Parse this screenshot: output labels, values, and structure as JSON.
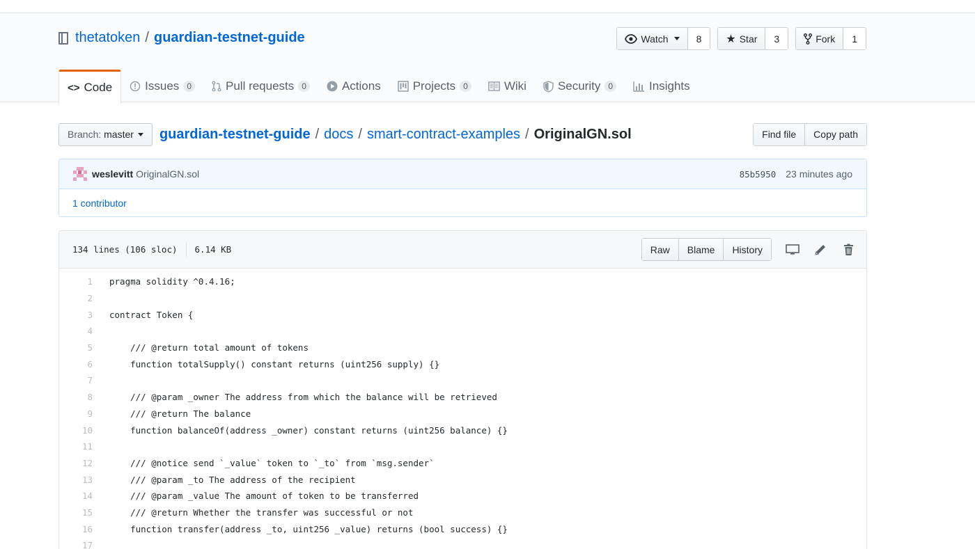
{
  "repo": {
    "owner": "thetatoken",
    "name": "guardian-testnet-guide",
    "sep": "/"
  },
  "actions": {
    "watch": {
      "label": "Watch",
      "count": "8"
    },
    "star": {
      "label": "Star",
      "count": "3"
    },
    "fork": {
      "label": "Fork",
      "count": "1"
    }
  },
  "tabs": [
    {
      "label": "Code",
      "icon": "code-icon"
    },
    {
      "label": "Issues",
      "count": "0",
      "icon": "issue-icon"
    },
    {
      "label": "Pull requests",
      "count": "0",
      "icon": "pull-request-icon"
    },
    {
      "label": "Actions",
      "icon": "play-icon"
    },
    {
      "label": "Projects",
      "count": "0",
      "icon": "project-icon"
    },
    {
      "label": "Wiki",
      "icon": "book-icon"
    },
    {
      "label": "Security",
      "count": "0",
      "icon": "shield-icon"
    },
    {
      "label": "Insights",
      "icon": "graph-icon"
    }
  ],
  "branch": {
    "label": "Branch:",
    "value": "master"
  },
  "breadcrumb": {
    "root": "guardian-testnet-guide",
    "parts": [
      "docs",
      "smart-contract-examples"
    ],
    "file": "OriginalGN.sol",
    "sep": "/"
  },
  "file_nav": {
    "find_file": "Find file",
    "copy_path": "Copy path"
  },
  "commit": {
    "author": "weslevitt",
    "message": "OriginalGN.sol",
    "sha": "85b5950",
    "time": "23 minutes ago",
    "contributors": "1 contributor"
  },
  "file": {
    "lines_info": "134 lines (106 sloc)",
    "size": "6.14 KB",
    "raw": "Raw",
    "blame": "Blame",
    "history": "History"
  },
  "code": [
    {
      "n": "1",
      "text": "pragma solidity ^0.4.16;"
    },
    {
      "n": "2",
      "text": ""
    },
    {
      "n": "3",
      "text": "contract Token {"
    },
    {
      "n": "4",
      "text": ""
    },
    {
      "n": "5",
      "text": "    /// @return total amount of tokens"
    },
    {
      "n": "6",
      "text": "    function totalSupply() constant returns (uint256 supply) {}"
    },
    {
      "n": "7",
      "text": ""
    },
    {
      "n": "8",
      "text": "    /// @param _owner The address from which the balance will be retrieved"
    },
    {
      "n": "9",
      "text": "    /// @return The balance"
    },
    {
      "n": "10",
      "text": "    function balanceOf(address _owner) constant returns (uint256 balance) {}"
    },
    {
      "n": "11",
      "text": ""
    },
    {
      "n": "12",
      "text": "    /// @notice send `_value` token to `_to` from `msg.sender`"
    },
    {
      "n": "13",
      "text": "    /// @param _to The address of the recipient"
    },
    {
      "n": "14",
      "text": "    /// @param _value The amount of token to be transferred"
    },
    {
      "n": "15",
      "text": "    /// @return Whether the transfer was successful or not"
    },
    {
      "n": "16",
      "text": "    function transfer(address _to, uint256 _value) returns (bool success) {}"
    },
    {
      "n": "17",
      "text": ""
    }
  ]
}
